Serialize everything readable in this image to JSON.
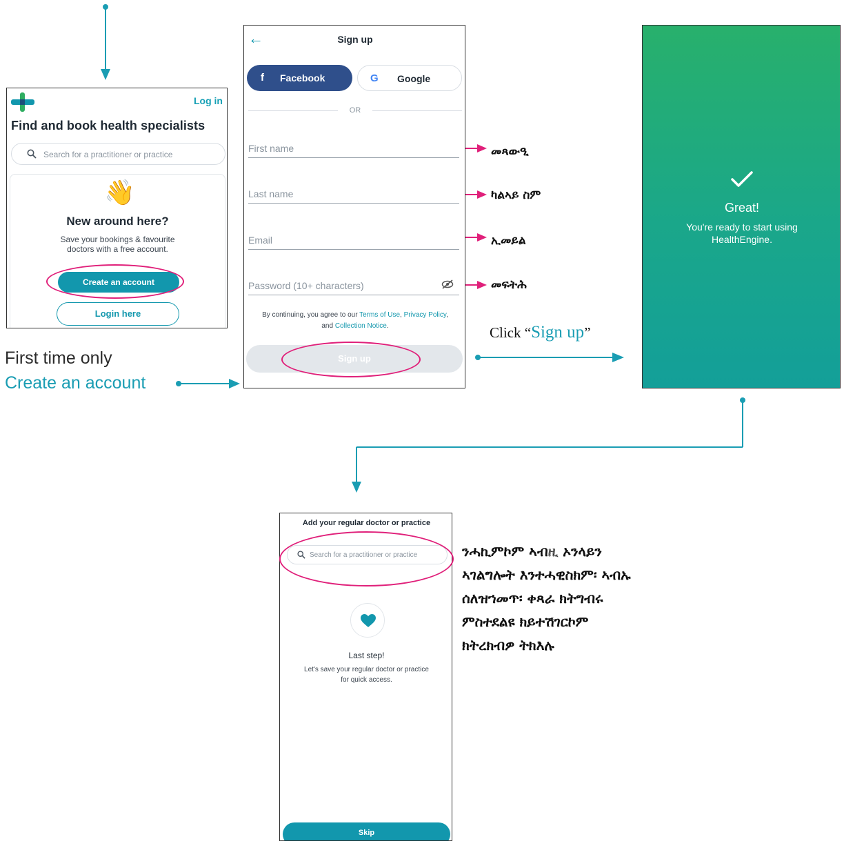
{
  "screens": {
    "home": {
      "login_link": "Log in",
      "title": "Find and book health specialists",
      "search_placeholder": "Search for a practitioner or practice",
      "new_title": "New around here?",
      "new_subtitle_line1": "Save your bookings & favourite",
      "new_subtitle_line2": "doctors with a free account.",
      "create_button": "Create an account",
      "login_button": "Login here",
      "icons": [
        "brand-logo-icon",
        "search-icon",
        "waving-hand-icon"
      ]
    },
    "signup": {
      "title": "Sign up",
      "facebook_label": "Facebook",
      "google_label": "Google",
      "or_label": "OR",
      "first_name_placeholder": "First name",
      "last_name_placeholder": "Last name",
      "email_placeholder": "Email",
      "password_placeholder": "Password (10+ characters)",
      "terms_prefix": "By continuing, you agree to our ",
      "terms_link": "Terms of Use",
      "terms_comma": ", ",
      "privacy_link": "Privacy Policy",
      "terms_and": ", and ",
      "collection_link": "Collection Notice",
      "terms_end": ".",
      "signup_button": "Sign up",
      "icons": [
        "back-arrow-icon",
        "facebook-icon",
        "google-icon",
        "eye-hidden-icon"
      ]
    },
    "success": {
      "title": "Great!",
      "message_line1": "You're ready to start using",
      "message_line2": "HealthEngine.",
      "icons": [
        "checkmark-icon"
      ]
    },
    "add_doctor": {
      "title": "Add your regular doctor or practice",
      "search_placeholder": "Search for a practitioner or practice",
      "last_step": "Last step!",
      "subtitle_line1": "Let's save your regular doctor or practice",
      "subtitle_line2": "for quick access.",
      "skip_button": "Skip",
      "icons": [
        "search-icon",
        "heart-icon"
      ]
    }
  },
  "annotations": {
    "first_time": "First time only",
    "create_account": "Create an account",
    "click_prefix": "Click “",
    "click_signup": "Sign up",
    "click_suffix": "”",
    "first_name_label": "መጻውዒ",
    "last_name_label": "ካልኣይ ስም",
    "email_label": "ኢመይል",
    "password_label": "መፍትሕ",
    "note_line1": "ንሓኪምኮም ኣብዚ ኦንላይን",
    "note_line2": "ኣገልግሎት እንተሓዊስክም፡ ኣብኡ",
    "note_line3": "ሰለዝኀመጥ፡ ቀጻራ ክትግብሩ",
    "note_line4": "ምስተደልዩ ክይተሽገርኮም",
    "note_line5": "ክትረክብዎ ትክእሉ"
  },
  "colors": {
    "teal": "#1297ad",
    "annotation_teal": "#1a9db3",
    "highlight_pink": "#e0207a",
    "facebook_blue": "#2f4f8b",
    "success_green": "#28b06c"
  }
}
